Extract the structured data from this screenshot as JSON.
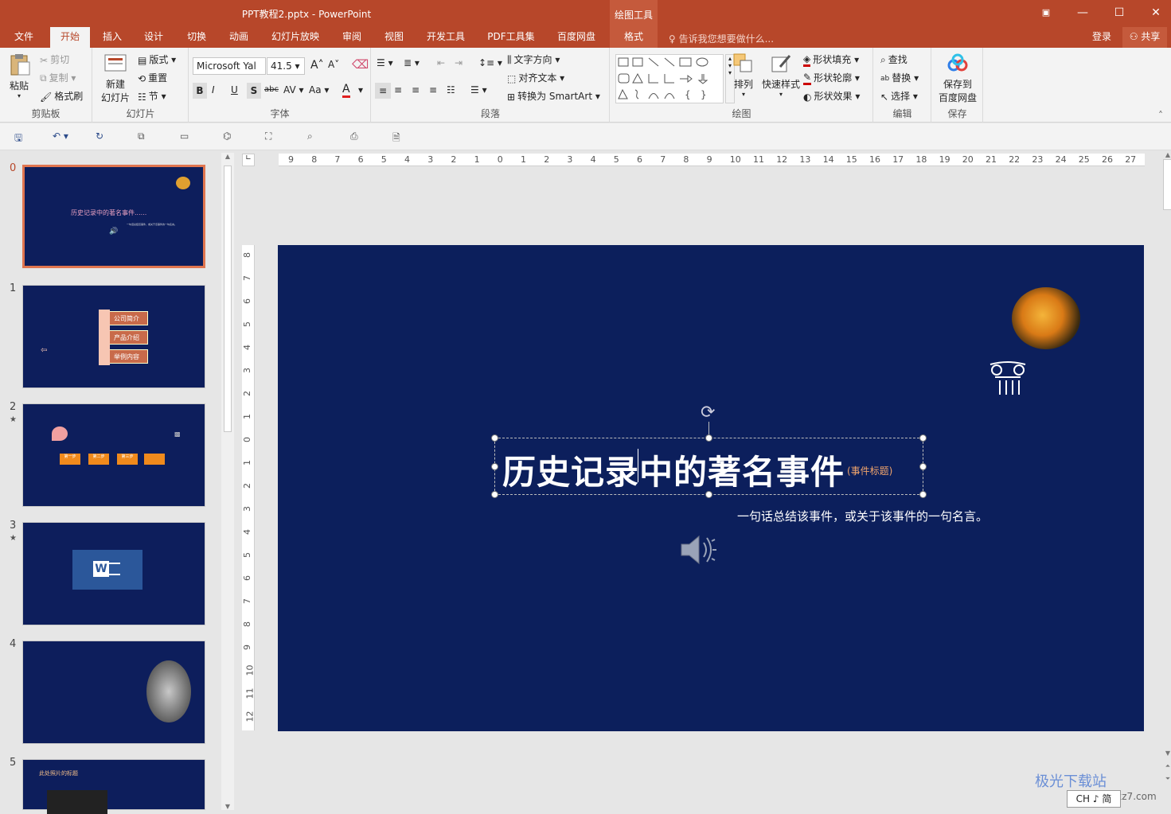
{
  "window": {
    "title": "PPT教程2.pptx - PowerPoint",
    "context_tool": "绘图工具"
  },
  "tabs": [
    "文件",
    "开始",
    "插入",
    "设计",
    "切换",
    "动画",
    "幻灯片放映",
    "审阅",
    "视图",
    "开发工具",
    "PDF工具集",
    "百度网盘",
    "格式"
  ],
  "tell_me": "告诉我您想要做什么...",
  "account": {
    "login": "登录",
    "share": "共享"
  },
  "clipboard": {
    "paste": "粘贴",
    "cut": "剪切",
    "copy": "复制",
    "format_painter": "格式刷",
    "label": "剪贴板"
  },
  "slides_group": {
    "new_slide_1": "新建",
    "new_slide_2": "幻灯片",
    "layout": "版式",
    "reset": "重置",
    "section": "节",
    "label": "幻灯片"
  },
  "font": {
    "name": "Microsoft Yal",
    "size": "41.5",
    "label": "字体",
    "bold": "B",
    "italic": "I",
    "underline": "U",
    "shadow": "S",
    "strike": "abc",
    "spacing": "AV",
    "case": "Aa",
    "color": "A",
    "grow": "A",
    "shrink": "A"
  },
  "paragraph": {
    "text_direction": "文字方向",
    "align_text": "对齐文本",
    "smartart": "转换为 SmartArt",
    "label": "段落"
  },
  "drawing": {
    "arrange": "排列",
    "quick_styles": "快速样式",
    "fill": "形状填充",
    "outline": "形状轮廓",
    "effects": "形状效果",
    "label": "绘图"
  },
  "editing": {
    "find": "查找",
    "replace": "替换",
    "select": "选择",
    "label": "编辑"
  },
  "save_group": {
    "line1": "保存到",
    "line2": "百度网盘",
    "label": "保存"
  },
  "thumbnails": [
    {
      "num": "0",
      "title": "历史记录中的著名事件......",
      "sub": "一句话总结该事件，或关于该事件的一句名言。"
    },
    {
      "num": "1",
      "items": [
        "公司简介",
        "产品介绍",
        "举例内容"
      ]
    },
    {
      "num": "2",
      "steps": [
        "第一步",
        "第二步",
        "第三步"
      ]
    },
    {
      "num": "3"
    },
    {
      "num": "4"
    },
    {
      "num": "5",
      "title": "此处照片的标题"
    }
  ],
  "slide": {
    "title": "历史记录中的著名事件",
    "tag": "(事件标题)",
    "subtitle": "一句话总结该事件，或关于该事件的一句名言。",
    "background": "#0c1f5c"
  },
  "ruler_h": [
    "9",
    "8",
    "7",
    "6",
    "5",
    "4",
    "3",
    "2",
    "1",
    "0",
    "1",
    "2",
    "3",
    "4",
    "5",
    "6",
    "7",
    "8",
    "9",
    "10",
    "11",
    "12",
    "13",
    "14",
    "15",
    "16",
    "17",
    "18",
    "19",
    "20",
    "21",
    "22",
    "23",
    "24",
    "25",
    "26",
    "27"
  ],
  "ruler_v": [
    "8",
    "7",
    "6",
    "5",
    "4",
    "3",
    "2",
    "1",
    "0",
    "1",
    "2",
    "3",
    "4",
    "5",
    "6",
    "7",
    "8",
    "9",
    "10",
    "11",
    "12"
  ],
  "watermark": "极光下载站",
  "watermark_url": "www.xz7.com",
  "ime": "CH ♪ 简",
  "colors": {
    "accent": "#b7472a",
    "ribbon": "#f3f3f3"
  }
}
